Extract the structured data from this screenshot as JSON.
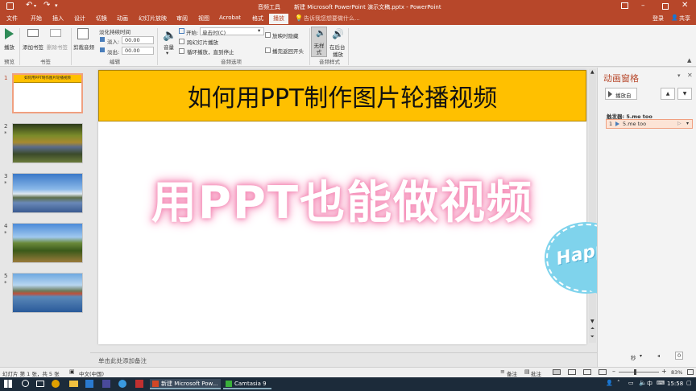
{
  "titlebar": {
    "tools_label": "音频工具",
    "title": "新建 Microsoft PowerPoint 演示文稿.pptx - PowerPoint"
  },
  "tabs": [
    "文件",
    "开始",
    "插入",
    "设计",
    "切换",
    "动画",
    "幻灯片放映",
    "审阅",
    "视图",
    "Acrobat",
    "格式",
    "播放"
  ],
  "active_tab": "播放",
  "tell_me": "告诉我您想要做什么...",
  "login": "登录",
  "share": "共享",
  "ribbon": {
    "play": "播放",
    "add_bookmark": "添加书签",
    "remove_bookmark": "删除书签",
    "trim_audio": "剪裁音频",
    "fade_duration": "淡化持续时间",
    "fade_in_label": "淡入:",
    "fade_in_value": "00.00",
    "fade_out_label": "淡出:",
    "fade_out_value": "00.00",
    "volume": "音量",
    "start_label": "开始:",
    "start_value": "单击时(C)",
    "cross_slides": "跨幻灯片播放",
    "loop": "循环播放，直到停止",
    "hide_during_show": "放映时隐藏",
    "rewind": "播完返回开头",
    "no_style": "无样式",
    "play_bg_1": "在后台",
    "play_bg_2": "播放",
    "groups": {
      "preview": "预览",
      "bookmarks": "书签",
      "editing": "编辑",
      "audio_options": "音频选项",
      "audio_styles": "音频样式"
    }
  },
  "thumbs": [
    {
      "num": "1",
      "caption": "如何用PPT制作图片轮播视频"
    },
    {
      "num": "2"
    },
    {
      "num": "3"
    },
    {
      "num": "4"
    },
    {
      "num": "5"
    }
  ],
  "slide": {
    "title": "如何用PPT制作图片轮播视频",
    "big_text": "用PPT也能做视频",
    "sticker_text": "Happy"
  },
  "notes_placeholder": "单击此处添加备注",
  "anim_pane": {
    "title": "动画窗格",
    "play_from": "播放自",
    "trigger": "触发器: 5.me too",
    "item_num": "1",
    "item_label": "5.me too",
    "seconds": "秒",
    "zoom_value": "0"
  },
  "status": {
    "slide_info": "幻灯片 第 1 张，共 5 张",
    "language": "中文(中国)",
    "notes": "备注",
    "comments": "批注",
    "zoom": "83%"
  },
  "taskbar": {
    "item1": "新建 Microsoft Pow...",
    "item2": "Camtasia 9",
    "ime": "中",
    "clock": "15:58"
  },
  "colors": {
    "brand": "#b7472a",
    "title_fill": "#ffc000",
    "glow": "#f58fb8",
    "sticker": "#7fd3ec",
    "taskbar": "#1c2b3a"
  }
}
